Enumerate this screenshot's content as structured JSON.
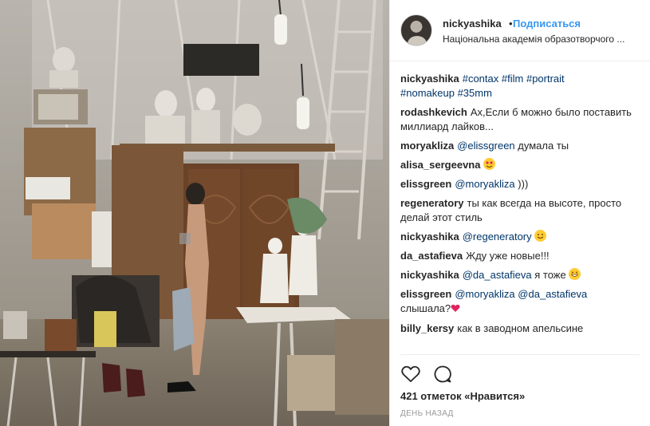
{
  "post": {
    "author": "nickyashika",
    "dot": "•",
    "follow_label": "Подписаться",
    "location": "Національна академія образотворчого ...",
    "caption_tags": [
      "#contax",
      "#film",
      "#portrait",
      "#nomakeup",
      "#35mm"
    ],
    "likes_text": "421 отметок «Нравится»",
    "time_text": "День назад"
  },
  "comments": [
    {
      "user": "nickyashika",
      "parts": [
        "#contax #film #portrait #nomakeup #35mm"
      ],
      "is_caption": true
    },
    {
      "user": "rodashkevich",
      "text": "Ах,Если б можно было поставить миллиард лайков..."
    },
    {
      "user": "moryakliza",
      "mention": "@elissgreen",
      "text": "думала ты"
    },
    {
      "user": "alisa_sergeevna",
      "emoji": "heart-eyes-emoji"
    },
    {
      "user": "elissgreen",
      "mention": "@moryakliza",
      "text": ")))"
    },
    {
      "user": "regeneratory",
      "text": "ты как всегда на высоте, просто делай этот стиль"
    },
    {
      "user": "nickyashika",
      "mention": "@regeneratory",
      "emoji": "smile-emoji"
    },
    {
      "user": "da_astafieva",
      "text": "Жду уже новые!!!"
    },
    {
      "user": "nickyashika",
      "mention": "@da_astafieva",
      "text": "я тоже",
      "emoji": "grin-emoji"
    },
    {
      "user": "elissgreen",
      "mention": "@moryakliza",
      "mention2": "@da_astafieva",
      "text": "слышала?",
      "emoji": "heart-emoji"
    },
    {
      "user": "billy_kersy",
      "text": "как в заводном апельсине"
    }
  ],
  "icons": {
    "like": "heart-outline-icon",
    "comment": "comment-bubble-icon"
  },
  "colors": {
    "link_blue": "#3897f0",
    "hashtag": "#003569",
    "text": "#262626",
    "muted": "#999999"
  }
}
